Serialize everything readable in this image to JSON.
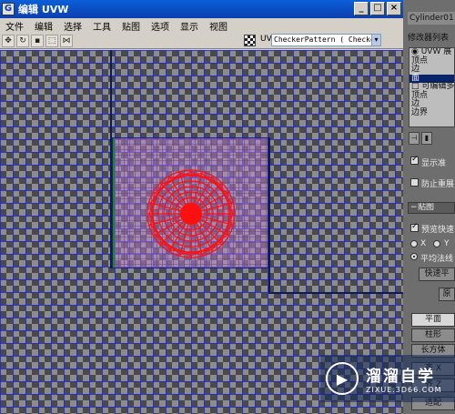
{
  "editor": {
    "title": "编辑 UVW",
    "menu": [
      "文件",
      "编辑",
      "选择",
      "工具",
      "贴图",
      "选项",
      "显示",
      "视图"
    ],
    "toolbar_icons": [
      "move-icon",
      "rotate-icon",
      "scale-icon",
      "freeform-icon",
      "mirror-icon"
    ],
    "uv_label": "UV",
    "map_select": "CheckerPattern  ( Checker",
    "window_buttons": {
      "minimize": "_",
      "maximize": "□",
      "close": "×"
    }
  },
  "panel": {
    "object_name": "Cylinder01",
    "modifier_list_label": "修改器列表",
    "stack": [
      {
        "label": "◉ UVW 展",
        "selected": false
      },
      {
        "label": "   顶点",
        "selected": false
      },
      {
        "label": "   边",
        "selected": false
      },
      {
        "label": "   面",
        "selected": true
      },
      {
        "label": "□ 可编辑多",
        "selected": false
      },
      {
        "label": "   顶点",
        "selected": false
      },
      {
        "label": "   边",
        "selected": false
      },
      {
        "label": "   边界",
        "selected": false
      }
    ],
    "show_checkbox_label": "显示准",
    "prevent_label": "防止重展",
    "rollup_mapping": "贴图",
    "preview_label": "预览快速",
    "axis_x": "X",
    "axis_y": "Y",
    "normal_label": "平均法线",
    "quick_btn": "快速平",
    "planar_btn": "平面",
    "cylindrical_btn": "柱形",
    "box_btn": "长方体",
    "align_x_btn": "齐 X",
    "align_z_btn": "齐 Z",
    "fit_btn": "适配",
    "misc_btn": "原"
  },
  "watermark": {
    "name": "溜溜自学",
    "url": "ZIXUE.3D66.COM"
  },
  "colors": {
    "uv_mesh": "#ff1010",
    "grid_blue": "#1e28dc",
    "selection_fill": "#be8cd2"
  }
}
